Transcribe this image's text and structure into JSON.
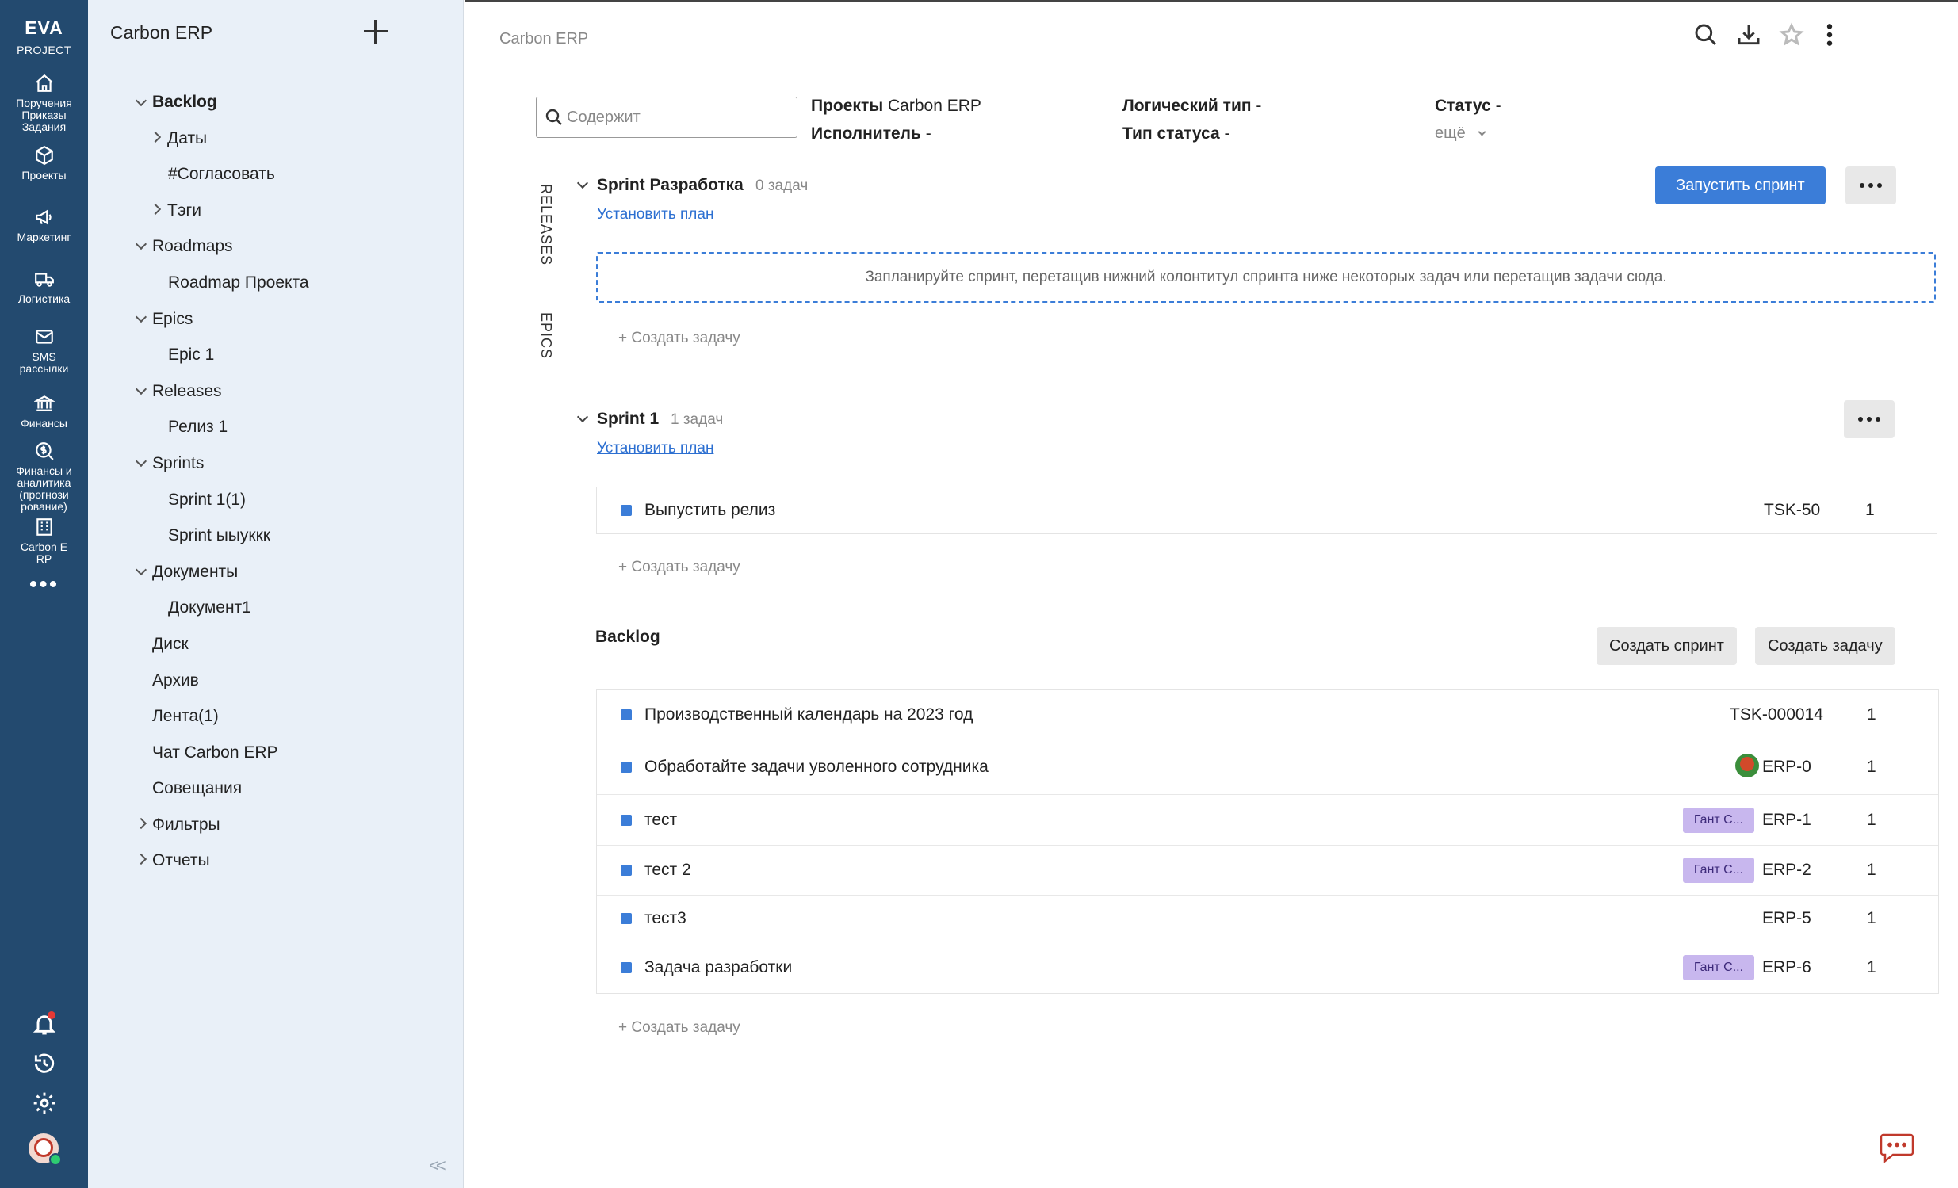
{
  "rail": {
    "brand_line1": "EVA",
    "brand_line2": "PROJECT",
    "items": [
      {
        "label1": "Поручения",
        "label2": "Приказы",
        "label3": "Задания",
        "icon": "home-icon"
      },
      {
        "label1": "Проекты",
        "icon": "cube-icon"
      },
      {
        "label1": "Маркетинг",
        "icon": "megaphone-icon"
      },
      {
        "label1": "Логистика",
        "icon": "truck-icon"
      },
      {
        "label1": "SMS",
        "label2": "рассылки",
        "icon": "mail-icon"
      },
      {
        "label1": "Финансы",
        "icon": "bank-icon"
      },
      {
        "label1": "Финансы и",
        "label2": "аналитика",
        "label3": "(прогнози",
        "label4": "рование)",
        "icon": "dollar-search-icon"
      },
      {
        "label1": "Carbon E",
        "label2": "RP",
        "icon": "building-icon"
      }
    ],
    "more": "•••"
  },
  "tree": {
    "title": "Carbon ERP",
    "items": [
      {
        "label": "Backlog"
      },
      {
        "label": "Даты"
      },
      {
        "label": "#Согласовать"
      },
      {
        "label": "Тэги"
      },
      {
        "label": "Roadmaps"
      },
      {
        "label": "Roadmap Проекта"
      },
      {
        "label": "Epics"
      },
      {
        "label": "Epic 1"
      },
      {
        "label": "Releases"
      },
      {
        "label": "Релиз 1"
      },
      {
        "label": "Sprints"
      },
      {
        "label": "Sprint 1(1)"
      },
      {
        "label": "Sprint ыыуккк"
      },
      {
        "label": "Документы"
      },
      {
        "label": "Документ1"
      },
      {
        "label": "Диск"
      },
      {
        "label": "Архив"
      },
      {
        "label": "Лента(1)"
      },
      {
        "label": "Чат Carbon ERP"
      },
      {
        "label": "Совещания"
      },
      {
        "label": "Фильтры"
      },
      {
        "label": "Отчеты"
      }
    ],
    "collapse": "<<"
  },
  "main": {
    "breadcrumb": "Carbon ERP",
    "search_placeholder": "Содержит",
    "filters": {
      "projects_label": "Проекты",
      "projects_value": "Carbon ERP",
      "logic_type_label": "Логический тип",
      "logic_type_value": "-",
      "status_label": "Статус",
      "status_value": "-",
      "assignee_label": "Исполнитель",
      "assignee_value": "-",
      "status_type_label": "Тип статуса",
      "status_type_value": "-",
      "more": "ещё"
    },
    "vtabs": {
      "releases": "RELEASES",
      "epics": "EPICS"
    },
    "sprint_dev": {
      "title": "Sprint Разработка",
      "count": "0 задач",
      "set_plan": "Установить план",
      "start_button": "Запустить спринт",
      "dropzone_text": "Запланируйте спринт, перетащив нижний колонтитул спринта ниже некоторых задач или перетащив задачи сюда.",
      "create_task": "+ Создать задачу"
    },
    "sprint1": {
      "title": "Sprint 1",
      "count": "1 задач",
      "set_plan": "Установить план",
      "tasks": [
        {
          "name": "Выпустить релиз",
          "key": "TSK-50",
          "points": "1"
        }
      ],
      "create_task": "+ Создать задачу"
    },
    "backlog": {
      "title": "Backlog",
      "create_sprint": "Создать спринт",
      "create_task_btn": "Создать задачу",
      "tasks": [
        {
          "name": "Производственный календарь на 2023 год",
          "key": "TSK-000014",
          "points": "1",
          "tag": ""
        },
        {
          "name": "Обработайте задачи уволенного сотрудника",
          "key": "ERP-0",
          "points": "1",
          "tag": ""
        },
        {
          "name": "тест",
          "key": "ERP-1",
          "points": "1",
          "tag": "Гант С..."
        },
        {
          "name": "тест 2",
          "key": "ERP-2",
          "points": "1",
          "tag": "Гант С..."
        },
        {
          "name": "тест3",
          "key": "ERP-5",
          "points": "1",
          "tag": ""
        },
        {
          "name": "Задача разработки",
          "key": "ERP-6",
          "points": "1",
          "tag": "Гант С..."
        }
      ],
      "create_task": "+ Создать задачу"
    }
  },
  "colors": {
    "rail_bg": "#234a6f",
    "tree_bg": "#e9f0f8",
    "accent": "#3b7dd8",
    "tag_bg": "#c8b7ee"
  }
}
